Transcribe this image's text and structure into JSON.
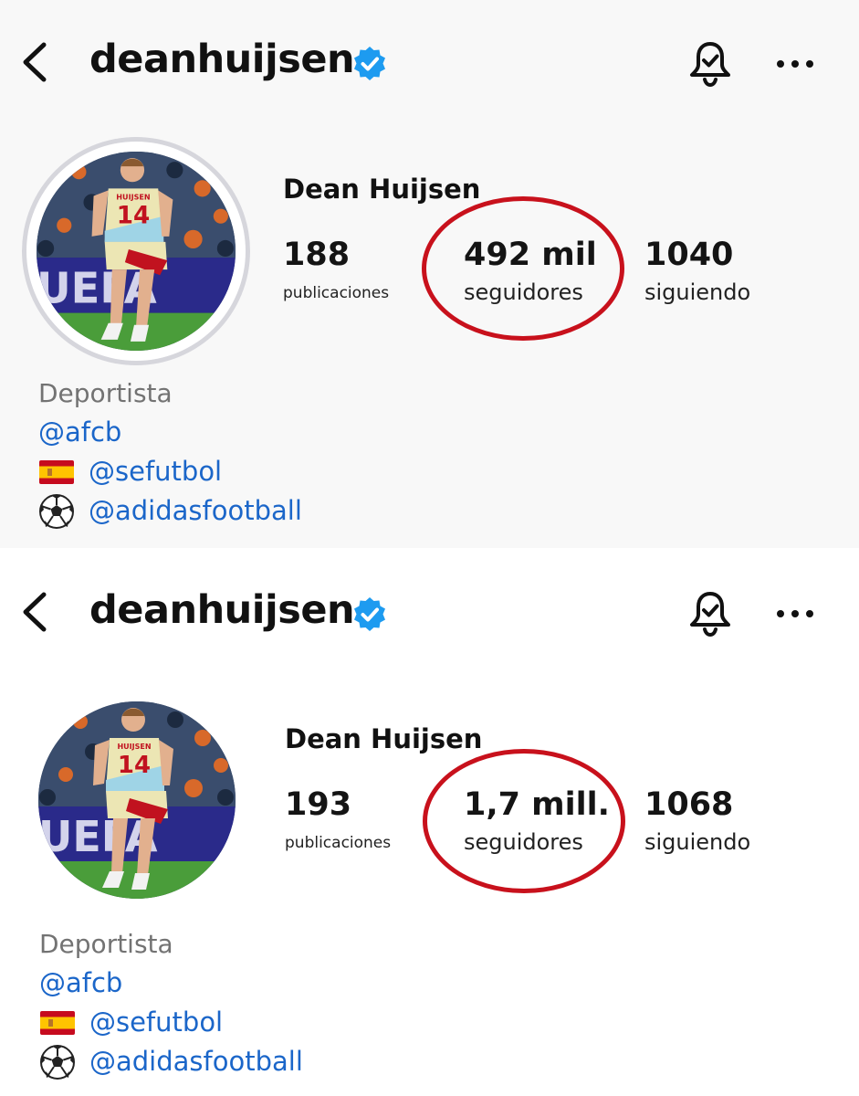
{
  "panels": [
    {
      "username": "deanhuijsen",
      "display_name": "Dean Huijsen",
      "stats": {
        "posts": {
          "value": "188",
          "label": "publicaciones"
        },
        "followers": {
          "value": "492 mil",
          "label": "seguidores"
        },
        "following": {
          "value": "1040",
          "label": "siguiendo"
        }
      },
      "bio": {
        "category": "Deportista",
        "links": [
          "@afcb",
          "@sefutbol",
          "@adidasfootball"
        ]
      }
    },
    {
      "username": "deanhuijsen",
      "display_name": "Dean Huijsen",
      "stats": {
        "posts": {
          "value": "193",
          "label": "publicaciones"
        },
        "followers": {
          "value": "1,7 mill.",
          "label": "seguidores"
        },
        "following": {
          "value": "1068",
          "label": "siguiendo"
        }
      },
      "bio": {
        "category": "Deportista",
        "links": [
          "@afcb",
          "@sefutbol",
          "@adidasfootball"
        ]
      }
    }
  ],
  "avatar_jersey_number": "14",
  "avatar_jersey_name": "HUIJSEN",
  "avatar_board_text": "UEFA",
  "icons": [
    "back-chevron-icon",
    "verified-badge-icon",
    "notification-bell-icon",
    "more-options-icon",
    "spain-flag-icon",
    "soccer-ball-icon"
  ],
  "colors": {
    "verified_blue": "#1d9bf0",
    "link_blue": "#1b66c9",
    "highlight_red": "#c8111c",
    "category_gray": "#737373"
  }
}
